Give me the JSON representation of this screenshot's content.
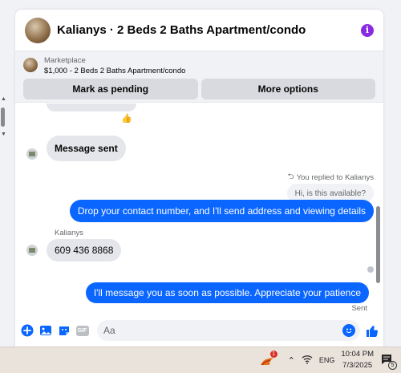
{
  "header": {
    "title": "Kalianys · 2 Beds 2 Baths Apartment/condo",
    "info_icon": "info-icon"
  },
  "listing": {
    "label": "Marketplace",
    "price_title": "$1,000 - 2 Beds 2 Baths Apartment/condo",
    "mark_pending_label": "Mark as pending",
    "more_options_label": "More options"
  },
  "messages": {
    "reaction": "👍",
    "msg_sent_text": "Message sent",
    "reply_note": "You replied to Kalianys",
    "quoted_text": "Hi, is this available?",
    "reply_text": "Drop your contact number, and I'll send address and viewing details",
    "sender_name": "Kalianys",
    "phone_text": "609 436 8868",
    "final_text": "I'll message you as soon as possible. Appreciate your patience",
    "status": "Sent"
  },
  "composer": {
    "placeholder": "Aa",
    "gif_label": "GIF"
  },
  "taskbar": {
    "app_badge": "1",
    "language": "ENG",
    "time": "10:04 PM",
    "date": "7/3/2025",
    "notification_count": "5"
  },
  "colors": {
    "accent": "#0a66ff",
    "bubble_in": "#e4e6eb",
    "info": "#8a2be2"
  }
}
